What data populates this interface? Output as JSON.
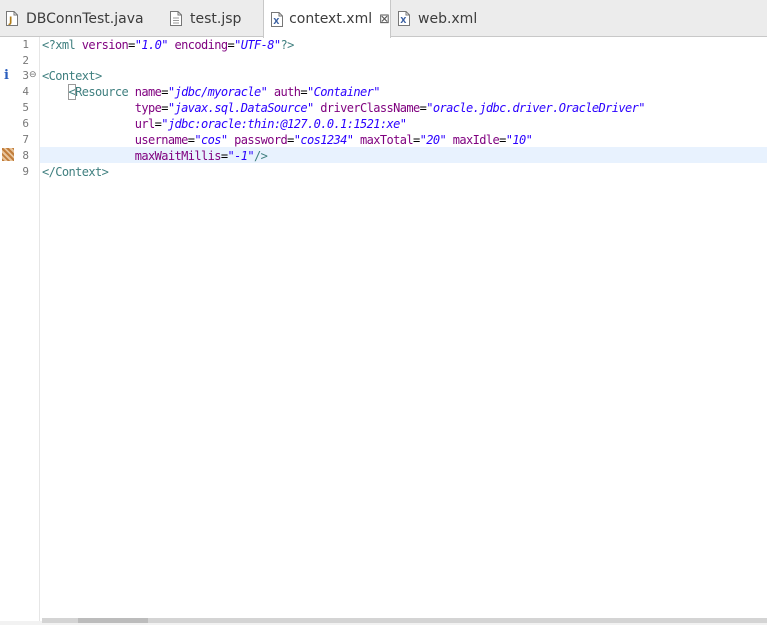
{
  "tabs": [
    {
      "label": "DBConnTest.java",
      "icon": "java-file-icon",
      "active": false
    },
    {
      "label": "test.jsp",
      "icon": "jsp-file-icon",
      "active": false
    },
    {
      "label": "context.xml",
      "icon": "xml-file-icon",
      "active": true,
      "close_glyph": "⊠"
    },
    {
      "label": "web.xml",
      "icon": "xml-file-icon",
      "active": false
    }
  ],
  "editor": {
    "line_numbers": [
      "1",
      "2",
      "3",
      "4",
      "5",
      "6",
      "7",
      "8",
      "9"
    ],
    "current_line": 8,
    "fold_glyph": "⊖",
    "info_marker": "i",
    "lines": {
      "l1": {
        "open": "<?xml",
        "a1": "version",
        "eq1": "=",
        "v1": "\"1.0\"",
        "a2": "encoding",
        "eq2": "=",
        "v2": "\"UTF-8\"",
        "close": "?>"
      },
      "l3": {
        "tag": "<Context>"
      },
      "l4": {
        "open": "<",
        "name": "Resource",
        "a1": "name",
        "eq1": "=",
        "v1": "\"jdbc/myoracle\"",
        "a2": "auth",
        "eq2": "=",
        "v2": "\"Container\""
      },
      "l5": {
        "a1": "type",
        "eq1": "=",
        "v1": "\"javax.sql.DataSource\"",
        "a2": "driverClassName",
        "eq2": "=",
        "v2": "\"oracle.jdbc.driver.OracleDriver\""
      },
      "l6": {
        "a1": "url",
        "eq1": "=",
        "v1": "\"jdbc:oracle:thin:@127.0.0.1:1521:xe\""
      },
      "l7": {
        "a1": "username",
        "eq1": "=",
        "v1": "\"cos\"",
        "a2": "password",
        "eq2": "=",
        "v2": "\"cos1234\"",
        "a3": "maxTotal",
        "eq3": "=",
        "v3": "\"20\"",
        "a4": "maxIdle",
        "eq4": "=",
        "v4": "\"10\""
      },
      "l8": {
        "a1": "maxWaitMillis",
        "eq1": "=",
        "v1": "\"-1\"",
        "close": "/>"
      },
      "l9": {
        "tag": "</Context>"
      }
    }
  },
  "colors": {
    "tag": "#3f7f7f",
    "attribute": "#7f007f",
    "value": "#2a00ff",
    "current_line_bg": "#e8f2fe"
  }
}
